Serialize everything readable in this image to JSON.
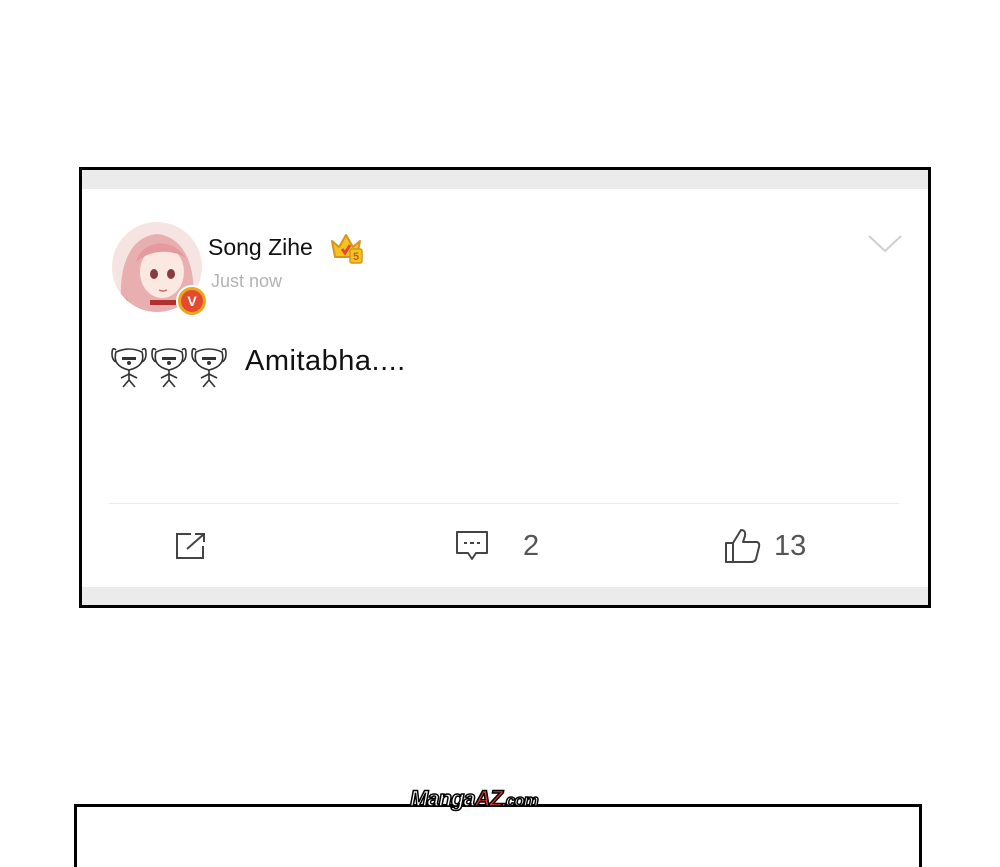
{
  "post": {
    "username": "Song Zihe",
    "timestamp": "Just now",
    "verified_badge": "V",
    "vip_level": "5",
    "text": "Amitabha....",
    "emoji_count": 3,
    "emoji_icon": "dog-facepalm-emoji"
  },
  "actions": {
    "share_icon": "share-icon",
    "comment_icon": "comment-icon",
    "comment_count": "2",
    "like_icon": "thumbs-up-icon",
    "like_count": "13"
  },
  "colors": {
    "badge_gold": "#e8a81e",
    "badge_red": "#e64a2e",
    "timestamp": "#b3b3b3",
    "strip": "#ebebeb"
  },
  "watermark": {
    "prefix": "Manga",
    "highlight": "AZ",
    "suffix": ".com"
  }
}
